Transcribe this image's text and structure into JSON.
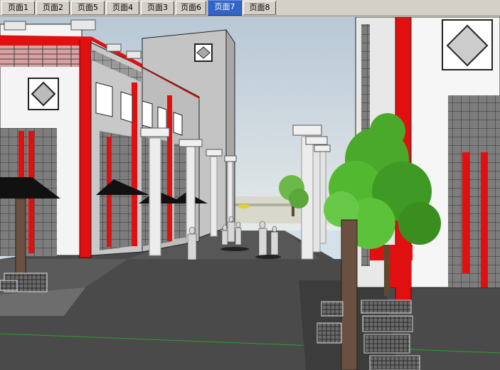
{
  "tabs": [
    {
      "label": "页面1"
    },
    {
      "label": "页面2"
    },
    {
      "label": "页面5"
    },
    {
      "label": "页面4"
    },
    {
      "label": "页面3"
    },
    {
      "label": "页面6"
    },
    {
      "label": "页面7",
      "active": true
    },
    {
      "label": "页面8"
    }
  ],
  "colors": {
    "accent_red": "#e01010",
    "active_tab": "#3165c6",
    "sky": "#c8d6e2",
    "pavement": "#4a4a4a",
    "foliage": "#3fa020"
  }
}
